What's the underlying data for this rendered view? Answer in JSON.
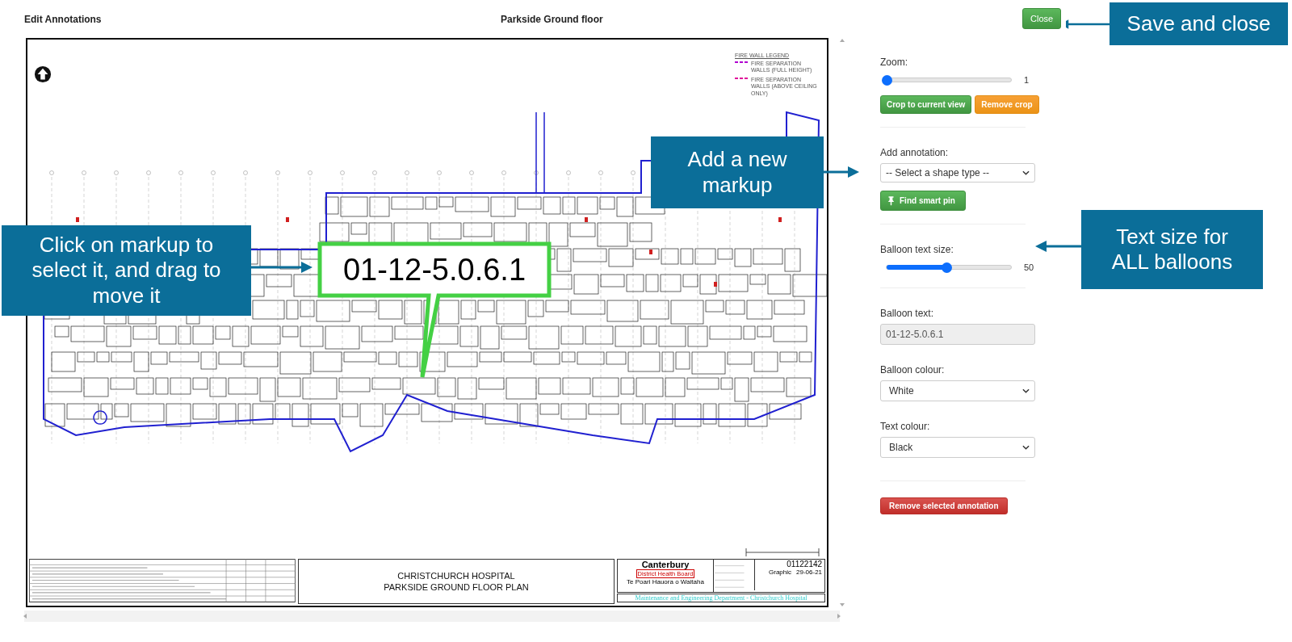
{
  "header": {
    "title": "Edit Annotations",
    "plan_title": "Parkside Ground floor"
  },
  "plan": {
    "legend": {
      "title": "FIRE WALL LEGEND",
      "items": [
        {
          "label": "FIRE SEPARATION WALLS (FULL HEIGHT)",
          "color": "#b000d0"
        },
        {
          "label": "FIRE SEPARATION WALLS (ABOVE CEILING ONLY)",
          "color": "#e0109a"
        }
      ]
    },
    "balloon": {
      "text": "01-12-5.0.6.1",
      "selected": true
    },
    "title_block": {
      "line_1": "CHRISTCHURCH HOSPITAL",
      "line_2": "PARKSIDE GROUND FLOOR PLAN",
      "org": "Canterbury",
      "org_sub": "District Health Board",
      "org_maori": "Te Poari Hauora o Waitaha",
      "drawing_no": "01122142",
      "status": "Graphic",
      "date": "29-06-21",
      "department": "Maintenance and Engineering Department - Christchurch Hospital"
    }
  },
  "panel": {
    "close": "Close",
    "zoom": {
      "label": "Zoom:",
      "level": 0,
      "reading": "1"
    },
    "crop_buttons": [
      {
        "label": "Crop to current view",
        "kind": "success"
      },
      {
        "label": "Remove crop",
        "kind": "warning"
      }
    ],
    "add_annotation": {
      "label": "Add annotation:",
      "value": "-- Select a shape type --"
    },
    "find_pin": "Find smart pin",
    "text_size": {
      "label": "Balloon text size:",
      "level": 0.48,
      "reading": "50"
    },
    "balloon_text": {
      "label": "Balloon text:",
      "value": "01-12-5.0.6.1",
      "disabled": true
    },
    "balloon_colour": {
      "label": "Balloon colour:",
      "value": "White"
    },
    "text_colour": {
      "label": "Text colour:",
      "value": "Black"
    },
    "remove": "Remove selected annotation"
  },
  "callouts": [
    {
      "text": "Save and close"
    },
    {
      "text": "Add a new markup"
    },
    {
      "text": "Click on markup to select it, and drag to move it"
    },
    {
      "text": "Text size for ALL balloons"
    }
  ]
}
